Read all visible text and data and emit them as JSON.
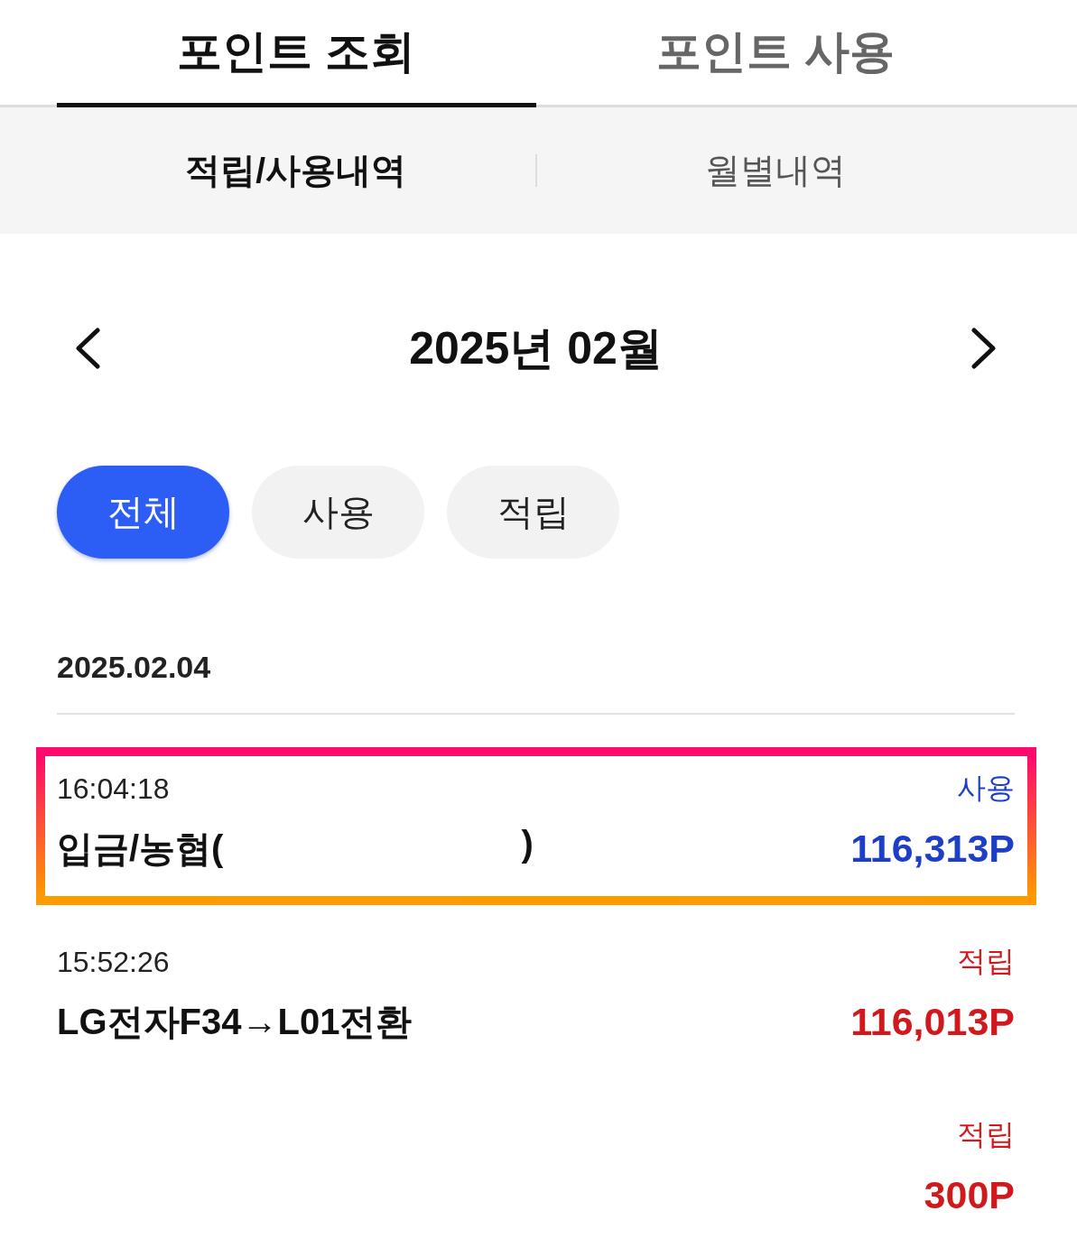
{
  "tabs": [
    {
      "label": "포인트 조회",
      "selected": true
    },
    {
      "label": "포인트 사용",
      "selected": false
    }
  ],
  "subtabs": [
    {
      "label": "적립/사용내역",
      "selected": true
    },
    {
      "label": "월별내역",
      "selected": false
    }
  ],
  "month": {
    "label": "2025년 02월"
  },
  "filters": [
    {
      "label": "전체",
      "selected": true
    },
    {
      "label": "사용",
      "selected": false
    },
    {
      "label": "적립",
      "selected": false
    }
  ],
  "date_groups": [
    {
      "date": "2025.02.04",
      "transactions": [
        {
          "time": "16:04:18",
          "description": [
            "입금/농협(",
            ")"
          ],
          "kind": "use",
          "type": "사용",
          "amount": "116,313P",
          "highlighted": true
        },
        {
          "time": "15:52:26",
          "description": [
            "LG전자F34→L01전환"
          ],
          "kind": "earn",
          "type": "적립",
          "amount": "116,013P",
          "highlighted": false
        },
        {
          "kind": "earn",
          "type": "적립",
          "amount": "300P",
          "highlighted": false
        }
      ]
    }
  ]
}
